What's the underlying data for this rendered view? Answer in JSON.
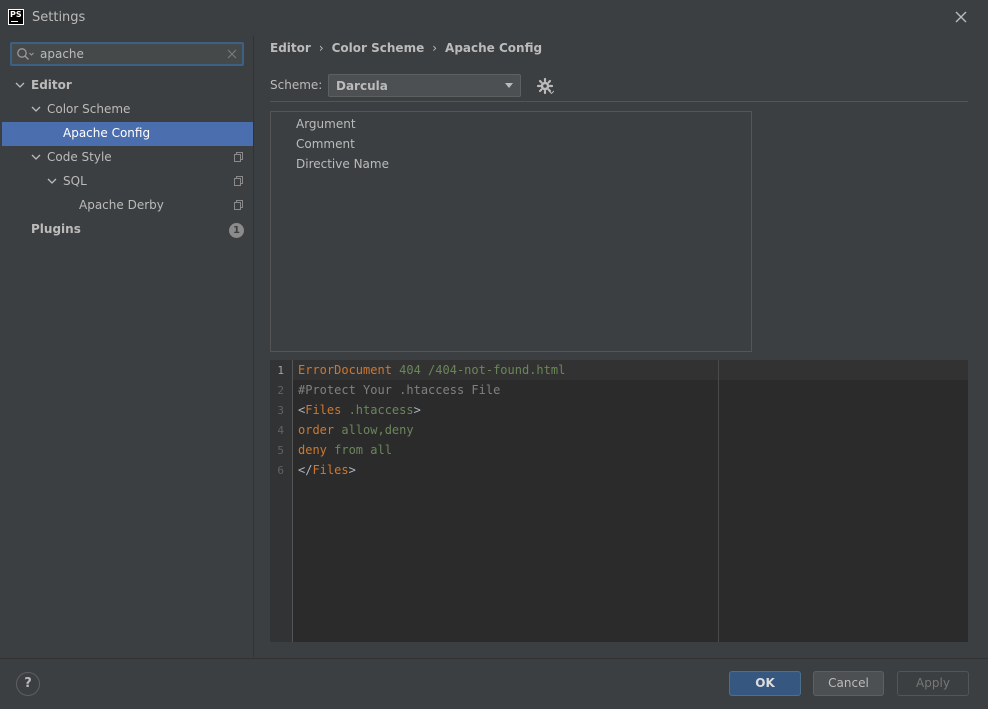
{
  "window": {
    "title": "Settings",
    "logo_text": "PS"
  },
  "search": {
    "value": "apache"
  },
  "tree": {
    "editor": "Editor",
    "color_scheme": "Color Scheme",
    "apache_config": "Apache Config",
    "code_style": "Code Style",
    "sql": "SQL",
    "apache_derby": "Apache Derby",
    "plugins": "Plugins",
    "plugins_badge": "1"
  },
  "breadcrumb": [
    "Editor",
    "Color Scheme",
    "Apache Config"
  ],
  "scheme": {
    "label": "Scheme:",
    "value": "Darcula"
  },
  "elements": [
    "Argument",
    "Comment",
    "Directive Name"
  ],
  "preview": {
    "line_numbers": [
      "1",
      "2",
      "3",
      "4",
      "5",
      "6"
    ],
    "l1_kw": "ErrorDocument",
    "l1_arg": " 404 /404-not-found.html",
    "l2_comment": "#Protect Your .htaccess File",
    "l3_open": "<",
    "l3_tag": "Files",
    "l3_arg": " .htaccess",
    "l3_close": ">",
    "l4_kw": "order",
    "l4_arg": " allow,deny",
    "l5_kw": "deny",
    "l5_arg": " from all",
    "l6_open": "</",
    "l6_tag": "Files",
    "l6_close": ">"
  },
  "buttons": {
    "help": "?",
    "ok": "OK",
    "cancel": "Cancel",
    "apply": "Apply"
  },
  "colors": {
    "selection": "#4b6eaf",
    "accent_ok": "#365880",
    "background": "#3c3f41",
    "editor_bg": "#2b2b2b"
  }
}
